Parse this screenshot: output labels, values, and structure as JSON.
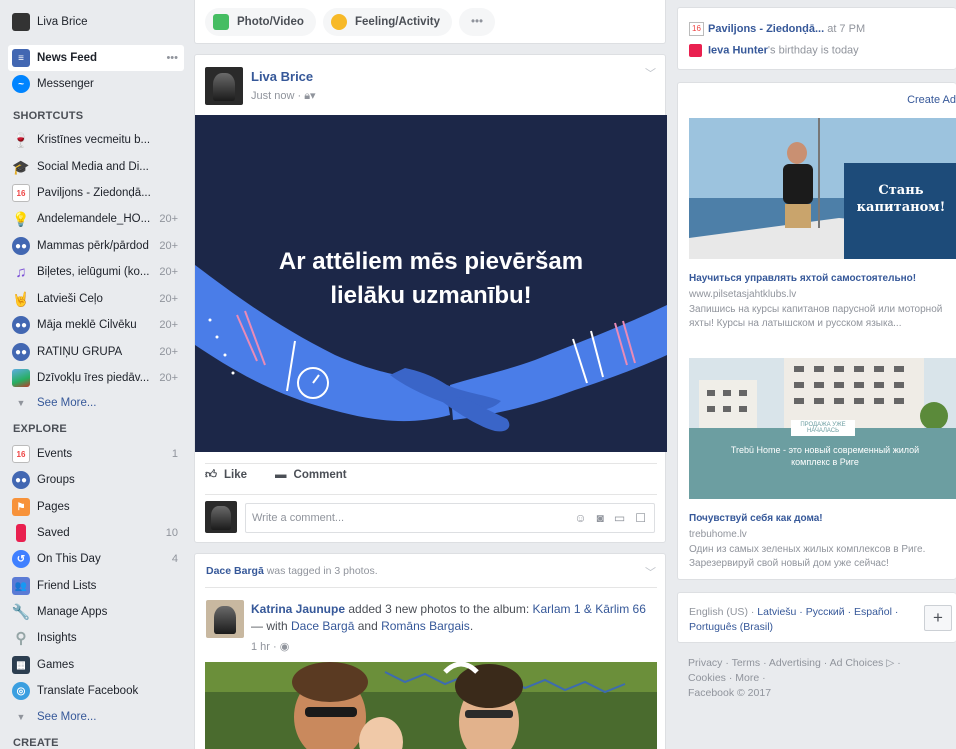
{
  "user": {
    "name": "Liva Brice"
  },
  "nav": {
    "main": [
      {
        "label": "News Feed",
        "extra": "•••"
      },
      {
        "label": "Messenger"
      }
    ],
    "shortcuts_heading": "SHORTCUTS",
    "shortcuts": [
      {
        "label": "Kristīnes vecmeitu b...",
        "count": ""
      },
      {
        "label": "Social Media and Di...",
        "count": ""
      },
      {
        "label": "Paviljons - Ziedonḍā...",
        "count": ""
      },
      {
        "label": "Andelemandele_HO...",
        "count": "20+"
      },
      {
        "label": "Mammas pērk/pārdod",
        "count": "20+"
      },
      {
        "label": "Biļetes, ielūgumi (ko...",
        "count": "20+"
      },
      {
        "label": "Latvieši Čeļo",
        "count": "20+"
      },
      {
        "label": "Māja meklē Cilvēku",
        "count": "20+"
      },
      {
        "label": "RATIŅU GRUPA",
        "count": "20+"
      },
      {
        "label": "Dzīvokļu īres piedāv...",
        "count": "20+"
      }
    ],
    "see_more": "See More...",
    "explore_heading": "EXPLORE",
    "explore": [
      {
        "label": "Events",
        "count": "1"
      },
      {
        "label": "Groups",
        "count": ""
      },
      {
        "label": "Pages",
        "count": ""
      },
      {
        "label": "Saved",
        "count": "10"
      },
      {
        "label": "On This Day",
        "count": "4"
      },
      {
        "label": "Friend Lists",
        "count": ""
      },
      {
        "label": "Manage Apps",
        "count": ""
      },
      {
        "label": "Insights",
        "count": ""
      },
      {
        "label": "Games",
        "count": ""
      },
      {
        "label": "Translate Facebook",
        "count": ""
      }
    ],
    "see_more_2": "See More...",
    "create_heading": "CREATE"
  },
  "composer": {
    "photo": "Photo/Video",
    "feeling": "Feeling/Activity",
    "more": "•••"
  },
  "post1": {
    "author": "Liva Brice",
    "time": "Just now ·",
    "banner_line1": "Ar attēliem mēs pievēršam",
    "banner_line2": "lielāku uzmanību!",
    "like": "Like",
    "comment": "Comment",
    "comment_placeholder": "Write a comment..."
  },
  "post2": {
    "tagged_name": "Dace Bargā",
    "tagged_text": " was tagged in 3 photos.",
    "author": "Katrina Jaunupe",
    "added_text": " added 3 new photos to the album: ",
    "album": "Karlam 1 & Kārlim 66",
    "with_text": " — with ",
    "with1": "Dace Bargā",
    "and_text": " and ",
    "with2": "Romāns Bargais",
    "end": ".",
    "time": "1 hr ·"
  },
  "right": {
    "event_name": "Paviljons - Ziedonḍā...",
    "event_time": " at 7 PM",
    "bday_name": "Ieva Hunter",
    "bday_text": "'s birthday is today",
    "create_ad": "Create Ad",
    "ad1": {
      "img_text_1": "Стань",
      "img_text_2": "капитаном!",
      "title": "Научиться управлять яхтой самостоятельно!",
      "url": "www.pilsetasjahtklubs.lv",
      "desc": "Запишись на курсы капитанов парусной или моторной яхты! Курсы на латышском и русском языка..."
    },
    "ad2": {
      "img_badge": "ПРОДАЖА УЖЕ НАЧАЛАСЬ",
      "img_text": "Trebū Home - это новый современный жилой комплекс в Риге",
      "title": "Почувствуй себя как дома!",
      "url": "trebuhome.lv",
      "desc": "Один из самых зеленых жилых комплексов в Риге. Зарезервируй свой новый дом уже сейчас!"
    },
    "lang_current": "English (US) · ",
    "lang_options": "Latviešu · Русский · Español · Português (Brasil)",
    "plus": "+",
    "footer_links": "Privacy · Terms · Advertising · Ad Choices ▷ · Cookies · More ·",
    "copyright": "Facebook © 2017"
  },
  "colors": {
    "link": "#365899",
    "bg": "#e9ebee",
    "banner_bg": "#1c2748",
    "hand": "#4a7de8"
  }
}
